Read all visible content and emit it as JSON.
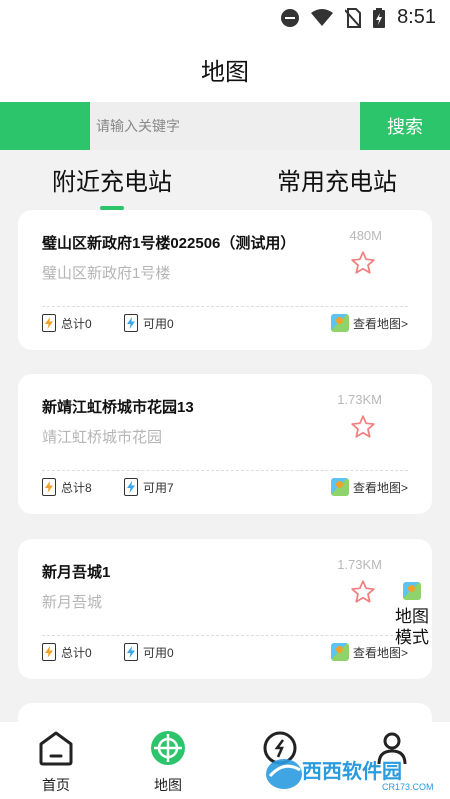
{
  "status_bar": {
    "time": "8:51"
  },
  "header": {
    "title": "地图"
  },
  "search": {
    "placeholder": "请输入关键字",
    "button_label": "搜索"
  },
  "tabs": [
    {
      "label": "附近充电站",
      "active": true
    },
    {
      "label": "常用充电站",
      "active": false
    }
  ],
  "stations": [
    {
      "name": "璧山区新政府1号楼022506（测试用）",
      "address": "璧山区新政府1号楼",
      "distance": "480M",
      "total": "总计0",
      "available": "可用0",
      "map_link": "查看地图>"
    },
    {
      "name": "新靖江虹桥城市花园13",
      "address": "靖江虹桥城市花园",
      "distance": "1.73KM",
      "total": "总计8",
      "available": "可用7",
      "map_link": "查看地图>"
    },
    {
      "name": "新月吾城1",
      "address": "新月吾城",
      "distance": "1.73KM",
      "total": "总计0",
      "available": "可用0",
      "map_link": "查看地图>"
    }
  ],
  "map_mode": {
    "line1": "地图",
    "line2": "模式"
  },
  "bottom_nav": [
    {
      "label": "首页",
      "icon": "home-icon"
    },
    {
      "label": "地图",
      "icon": "map-target-icon",
      "active": true
    },
    {
      "label": "",
      "icon": "scan-icon"
    },
    {
      "label": "",
      "icon": "profile-icon"
    }
  ],
  "watermark": {
    "text": "西西软件园",
    "sub": "CR173.COM"
  },
  "colors": {
    "accent": "#2dc56c",
    "star": "#f08080"
  }
}
